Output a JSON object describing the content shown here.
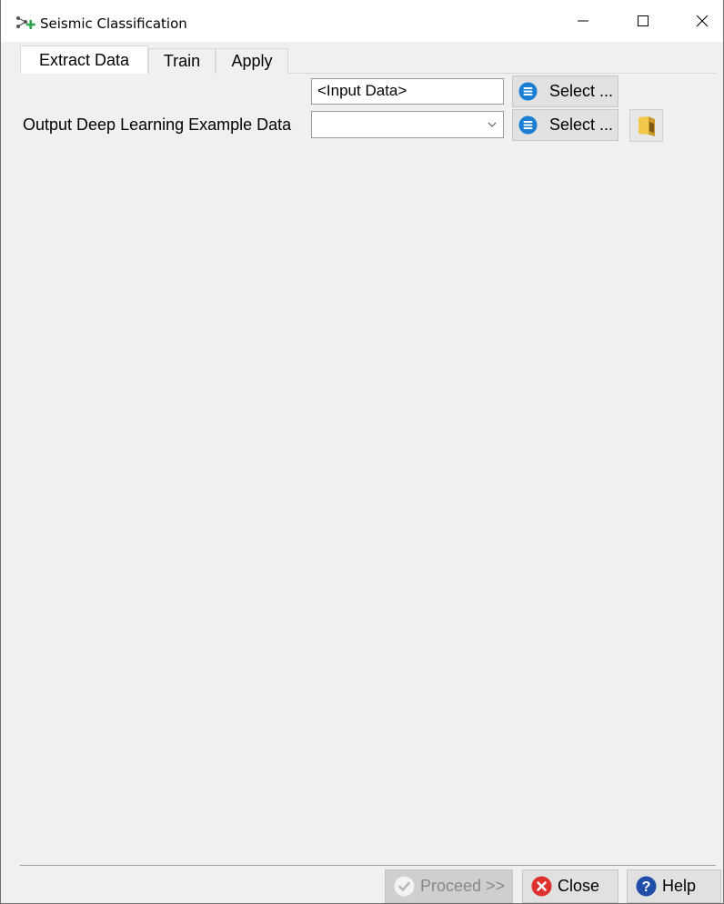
{
  "window": {
    "title": "Seismic Classification",
    "icons": {
      "app": "seismic-classification-icon",
      "minimize": "minimize-icon",
      "maximize": "maximize-icon",
      "close": "close-icon"
    }
  },
  "tabs": [
    {
      "label": "Extract Data",
      "active": true
    },
    {
      "label": "Train",
      "active": false
    },
    {
      "label": "Apply",
      "active": false
    }
  ],
  "form": {
    "input_data": {
      "value": "<Input Data>"
    },
    "input_select_label": "Select ...",
    "output_label": "Output Deep Learning Example Data",
    "output_value": "",
    "output_select_label": "Select ...",
    "icons": {
      "select": "list-icon",
      "browse": "folder-icon",
      "dropdown": "chevron-down-icon"
    }
  },
  "footer": {
    "proceed_label": "Proceed >>",
    "proceed_enabled": false,
    "close_label": "Close",
    "help_label": "Help",
    "icons": {
      "proceed": "checkmark-icon",
      "close": "close-x-icon",
      "help": "help-icon"
    }
  },
  "colors": {
    "accent_blue": "#1a7fd4",
    "close_red": "#e02f2f",
    "help_blue": "#1f4ea8",
    "folder_yellow": "#f2c94c"
  }
}
